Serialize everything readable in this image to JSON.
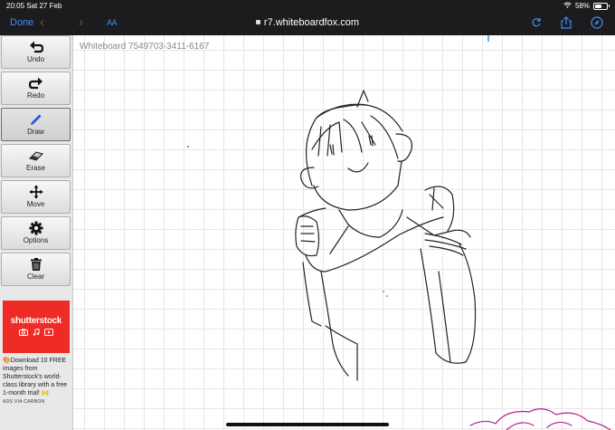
{
  "status_bar": {
    "time_date": "20:05  Sat 27 Feb",
    "battery": "58%",
    "battery_level": 0.58
  },
  "browser": {
    "done_label": "Done",
    "text_size_label": "AA",
    "url": "r7.whiteboardfox.com"
  },
  "tools": [
    {
      "label": "Undo",
      "icon": "undo-icon"
    },
    {
      "label": "Redo",
      "icon": "redo-icon"
    },
    {
      "label": "Draw",
      "icon": "pencil-icon",
      "active": true
    },
    {
      "label": "Erase",
      "icon": "eraser-icon"
    },
    {
      "label": "Move",
      "icon": "move-icon"
    },
    {
      "label": "Options",
      "icon": "gear-icon"
    },
    {
      "label": "Clear",
      "icon": "trash-icon"
    }
  ],
  "ad": {
    "brand": "shutterstock",
    "text": "🎨Download 10 FREE images from Shutterstock's world-class library with a free 1-month trial! 🙌",
    "via": "ADS VIA CARBON",
    "brand_color": "#ee2b24"
  },
  "whiteboard": {
    "title": "Whiteboard 7549703-3411-6167"
  }
}
